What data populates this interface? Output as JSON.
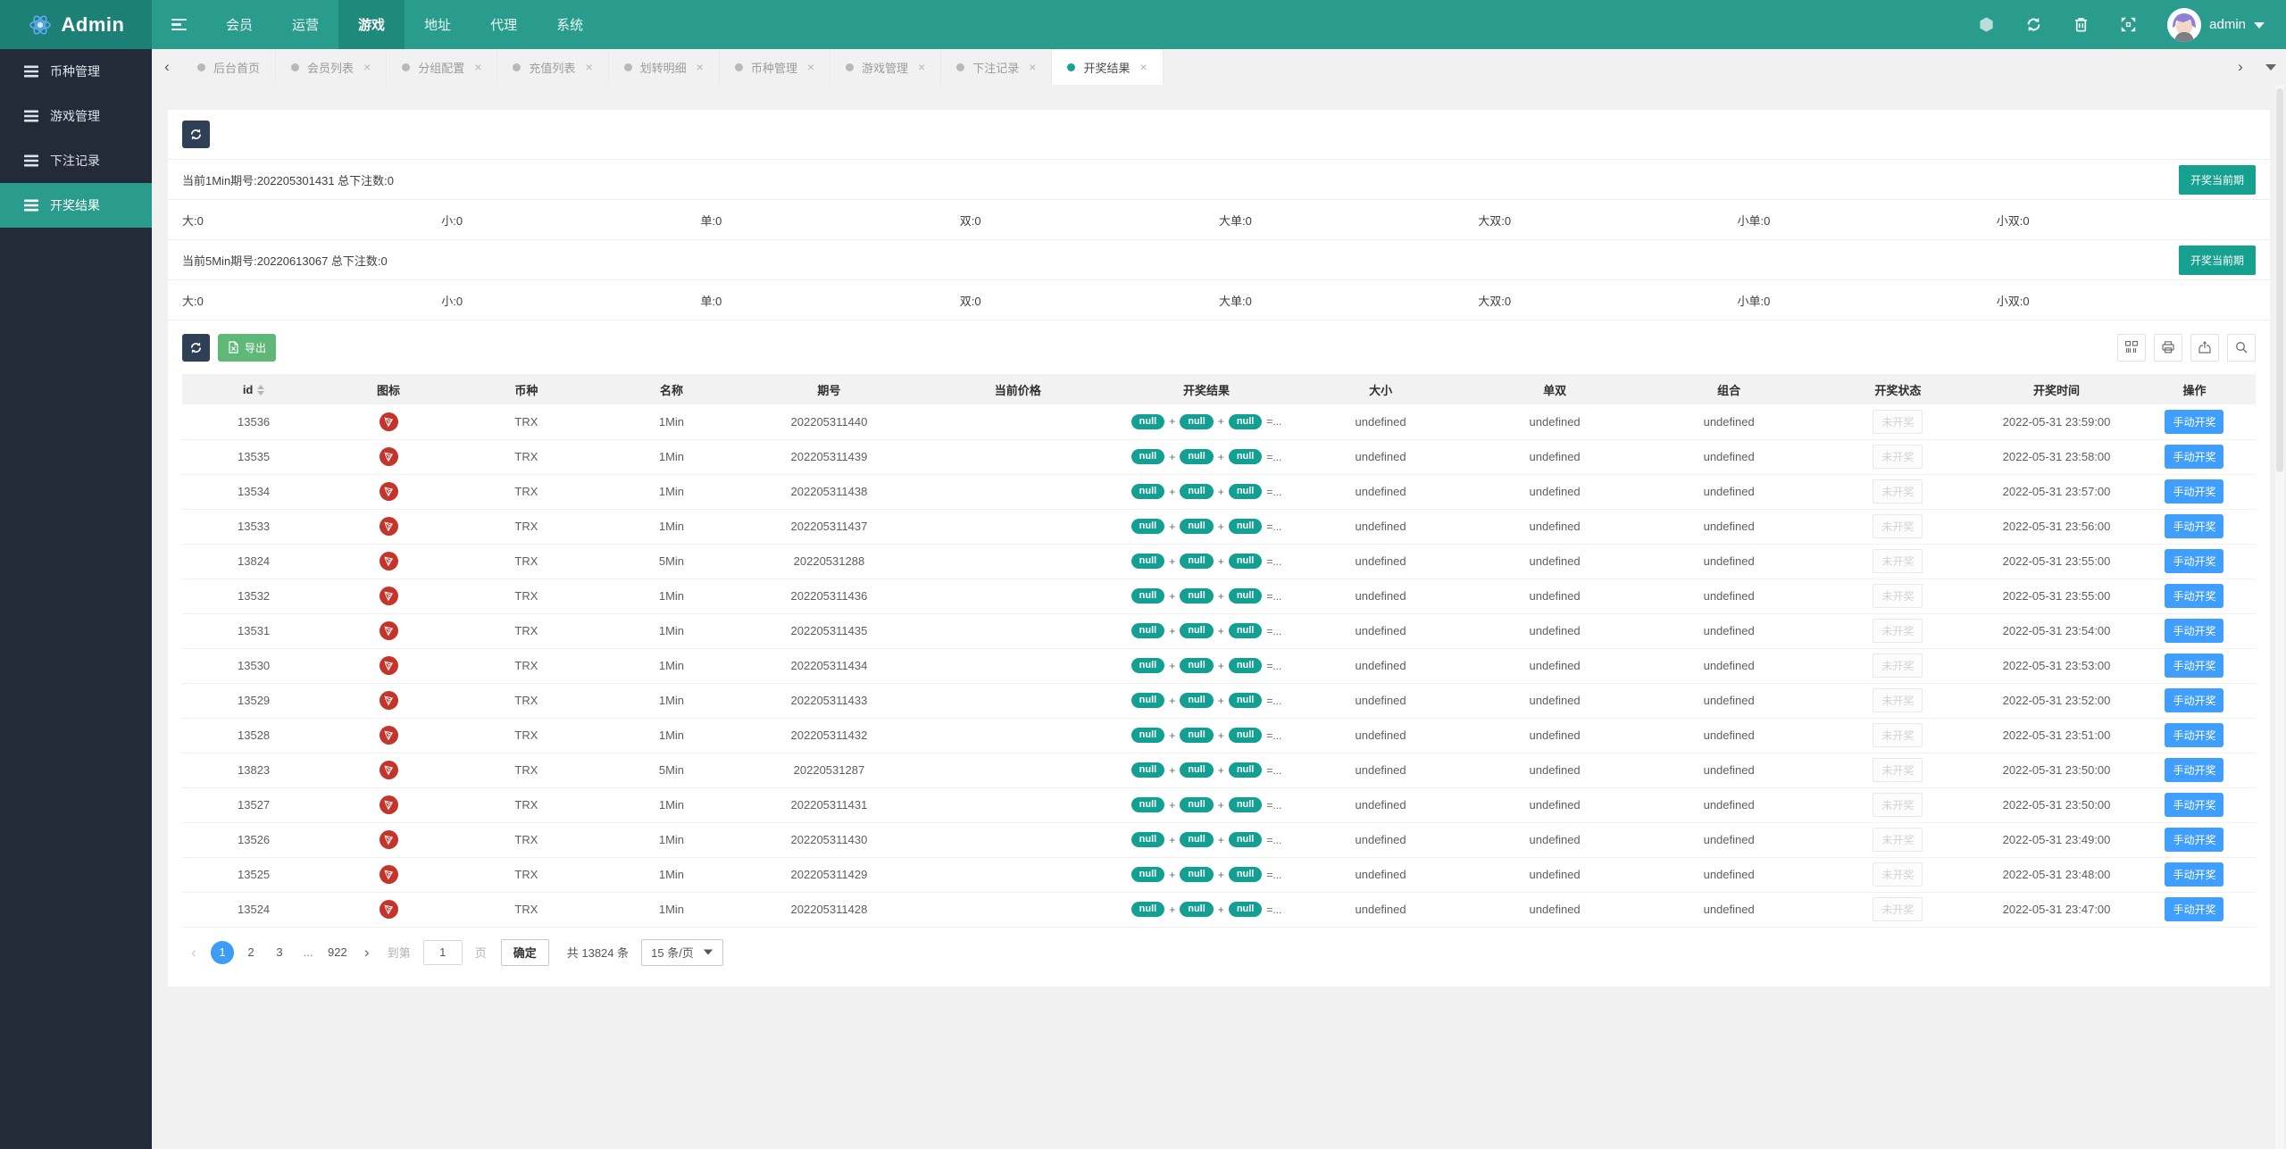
{
  "theme": {
    "header_teal": "#2a9c8d",
    "logo_teal": "#1d8076",
    "nav_active_teal": "#1f8a7c",
    "sidebar_dark": "#242b38",
    "button_teal": "#16a08f",
    "button_navy": "#2f4056",
    "button_green": "#5fb878",
    "button_blue": "#409eff",
    "pill_teal": "#12a093",
    "tron_red": "#c4342b",
    "pagination_blue": "#3c9cf7"
  },
  "header": {
    "logo_text": "Admin",
    "logo_icon": "atom-icon",
    "nav_items": [
      {
        "label": "会员"
      },
      {
        "label": "运营"
      },
      {
        "label": "游戏",
        "active": true
      },
      {
        "label": "地址"
      },
      {
        "label": "代理"
      },
      {
        "label": "系统"
      }
    ],
    "right_icons": [
      "hexagon-icon",
      "refresh-icon",
      "trash-icon",
      "fullscreen-icon"
    ],
    "username": "admin"
  },
  "tabs": {
    "prev_glyph": "‹",
    "next_glyph": "›",
    "close_glyph": "×",
    "items": [
      {
        "label": "后台首页",
        "closable": false,
        "active": false
      },
      {
        "label": "会员列表",
        "closable": true,
        "active": false
      },
      {
        "label": "分组配置",
        "closable": true,
        "active": false
      },
      {
        "label": "充值列表",
        "closable": true,
        "active": false
      },
      {
        "label": "划转明细",
        "closable": true,
        "active": false
      },
      {
        "label": "币种管理",
        "closable": true,
        "active": false
      },
      {
        "label": "游戏管理",
        "closable": true,
        "active": false
      },
      {
        "label": "下注记录",
        "closable": true,
        "active": false
      },
      {
        "label": "开奖结果",
        "closable": true,
        "active": true
      }
    ]
  },
  "sidebar": {
    "items": [
      {
        "label": "币种管理",
        "active": false
      },
      {
        "label": "游戏管理",
        "active": false
      },
      {
        "label": "下注记录",
        "active": false
      },
      {
        "label": "开奖结果",
        "active": true
      }
    ]
  },
  "panels": [
    {
      "info": "当前1Min期号:202205301431 总下注数:0",
      "action_label": "开奖当前期",
      "stats": [
        "大:0",
        "小:0",
        "单:0",
        "双:0",
        "大单:0",
        "大双:0",
        "小单:0",
        "小双:0"
      ]
    },
    {
      "info": "当前5Min期号:20220613067 总下注数:0",
      "action_label": "开奖当前期",
      "stats": [
        "大:0",
        "小:0",
        "单:0",
        "双:0",
        "大单:0",
        "大双:0",
        "小单:0",
        "小双:0"
      ]
    }
  ],
  "toolbar": {
    "export_label": "导出",
    "right_tools": [
      "columns-icon",
      "print-icon",
      "export-icon",
      "search-icon"
    ]
  },
  "table": {
    "columns": [
      "id",
      "图标",
      "币种",
      "名称",
      "期号",
      "当前价格",
      "开奖结果",
      "大小",
      "单双",
      "组合",
      "开奖状态",
      "开奖时间",
      "操作"
    ],
    "result_pill": "null",
    "result_plus": "+",
    "result_tail": "=...",
    "rows": [
      {
        "id": "13536",
        "coin": "TRX",
        "name": "1Min",
        "issue": "202205311440",
        "price": "",
        "size": "undefined",
        "parity": "undefined",
        "combo": "undefined",
        "status": "未开奖",
        "time": "2022-05-31 23:59:00",
        "action": "手动开奖"
      },
      {
        "id": "13535",
        "coin": "TRX",
        "name": "1Min",
        "issue": "202205311439",
        "price": "",
        "size": "undefined",
        "parity": "undefined",
        "combo": "undefined",
        "status": "未开奖",
        "time": "2022-05-31 23:58:00",
        "action": "手动开奖"
      },
      {
        "id": "13534",
        "coin": "TRX",
        "name": "1Min",
        "issue": "202205311438",
        "price": "",
        "size": "undefined",
        "parity": "undefined",
        "combo": "undefined",
        "status": "未开奖",
        "time": "2022-05-31 23:57:00",
        "action": "手动开奖"
      },
      {
        "id": "13533",
        "coin": "TRX",
        "name": "1Min",
        "issue": "202205311437",
        "price": "",
        "size": "undefined",
        "parity": "undefined",
        "combo": "undefined",
        "status": "未开奖",
        "time": "2022-05-31 23:56:00",
        "action": "手动开奖"
      },
      {
        "id": "13824",
        "coin": "TRX",
        "name": "5Min",
        "issue": "20220531288",
        "price": "",
        "size": "undefined",
        "parity": "undefined",
        "combo": "undefined",
        "status": "未开奖",
        "time": "2022-05-31 23:55:00",
        "action": "手动开奖"
      },
      {
        "id": "13532",
        "coin": "TRX",
        "name": "1Min",
        "issue": "202205311436",
        "price": "",
        "size": "undefined",
        "parity": "undefined",
        "combo": "undefined",
        "status": "未开奖",
        "time": "2022-05-31 23:55:00",
        "action": "手动开奖"
      },
      {
        "id": "13531",
        "coin": "TRX",
        "name": "1Min",
        "issue": "202205311435",
        "price": "",
        "size": "undefined",
        "parity": "undefined",
        "combo": "undefined",
        "status": "未开奖",
        "time": "2022-05-31 23:54:00",
        "action": "手动开奖"
      },
      {
        "id": "13530",
        "coin": "TRX",
        "name": "1Min",
        "issue": "202205311434",
        "price": "",
        "size": "undefined",
        "parity": "undefined",
        "combo": "undefined",
        "status": "未开奖",
        "time": "2022-05-31 23:53:00",
        "action": "手动开奖"
      },
      {
        "id": "13529",
        "coin": "TRX",
        "name": "1Min",
        "issue": "202205311433",
        "price": "",
        "size": "undefined",
        "parity": "undefined",
        "combo": "undefined",
        "status": "未开奖",
        "time": "2022-05-31 23:52:00",
        "action": "手动开奖"
      },
      {
        "id": "13528",
        "coin": "TRX",
        "name": "1Min",
        "issue": "202205311432",
        "price": "",
        "size": "undefined",
        "parity": "undefined",
        "combo": "undefined",
        "status": "未开奖",
        "time": "2022-05-31 23:51:00",
        "action": "手动开奖"
      },
      {
        "id": "13823",
        "coin": "TRX",
        "name": "5Min",
        "issue": "20220531287",
        "price": "",
        "size": "undefined",
        "parity": "undefined",
        "combo": "undefined",
        "status": "未开奖",
        "time": "2022-05-31 23:50:00",
        "action": "手动开奖"
      },
      {
        "id": "13527",
        "coin": "TRX",
        "name": "1Min",
        "issue": "202205311431",
        "price": "",
        "size": "undefined",
        "parity": "undefined",
        "combo": "undefined",
        "status": "未开奖",
        "time": "2022-05-31 23:50:00",
        "action": "手动开奖"
      },
      {
        "id": "13526",
        "coin": "TRX",
        "name": "1Min",
        "issue": "202205311430",
        "price": "",
        "size": "undefined",
        "parity": "undefined",
        "combo": "undefined",
        "status": "未开奖",
        "time": "2022-05-31 23:49:00",
        "action": "手动开奖"
      },
      {
        "id": "13525",
        "coin": "TRX",
        "name": "1Min",
        "issue": "202205311429",
        "price": "",
        "size": "undefined",
        "parity": "undefined",
        "combo": "undefined",
        "status": "未开奖",
        "time": "2022-05-31 23:48:00",
        "action": "手动开奖"
      },
      {
        "id": "13524",
        "coin": "TRX",
        "name": "1Min",
        "issue": "202205311428",
        "price": "",
        "size": "undefined",
        "parity": "undefined",
        "combo": "undefined",
        "status": "未开奖",
        "time": "2022-05-31 23:47:00",
        "action": "手动开奖"
      }
    ]
  },
  "pagination": {
    "prev_glyph": "‹",
    "next_glyph": "›",
    "pages": [
      "1",
      "2",
      "3",
      "...",
      "922"
    ],
    "active_page": "1",
    "goto_label": "到第",
    "goto_value": "1",
    "page_unit": "页",
    "confirm_label": "确定",
    "total_label": "共 13824 条",
    "per_page_label": "15 条/页"
  }
}
